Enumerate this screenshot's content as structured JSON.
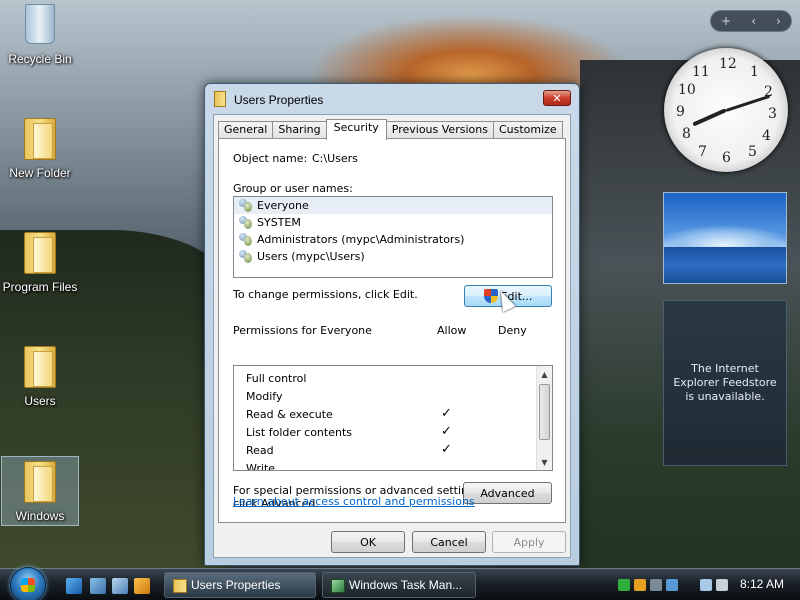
{
  "desktop": {
    "icons": [
      {
        "label": "Recycle Bin"
      },
      {
        "label": "New Folder"
      },
      {
        "label": "Program Files"
      },
      {
        "label": "Users"
      },
      {
        "label": "Windows"
      }
    ]
  },
  "gadgets": {
    "toolbar": {
      "add": "+",
      "prev": "‹",
      "next": "›"
    },
    "clock": {
      "time": "8:12"
    },
    "feed_message": "The Internet Explorer Feedstore is unavailable."
  },
  "window": {
    "title": "Users Properties",
    "close_glyph": "✕",
    "tabs": [
      {
        "label": "General"
      },
      {
        "label": "Sharing"
      },
      {
        "label": "Security"
      },
      {
        "label": "Previous Versions"
      },
      {
        "label": "Customize"
      }
    ],
    "active_tab": "Security",
    "object_name_label": "Object name:",
    "object_name_value": "C:\\Users",
    "group_label": "Group or user names:",
    "groups": [
      {
        "name": "Everyone"
      },
      {
        "name": "SYSTEM"
      },
      {
        "name": "Administrators (mypc\\Administrators)"
      },
      {
        "name": "Users (mypc\\Users)"
      }
    ],
    "change_text": "To change permissions, click Edit.",
    "edit_label": "Edit...",
    "permissions_label": "Permissions for Everyone",
    "allow_label": "Allow",
    "deny_label": "Deny",
    "permissions": [
      {
        "name": "Full control",
        "allow": "",
        "deny": ""
      },
      {
        "name": "Modify",
        "allow": "",
        "deny": ""
      },
      {
        "name": "Read & execute",
        "allow": "✓",
        "deny": ""
      },
      {
        "name": "List folder contents",
        "allow": "✓",
        "deny": ""
      },
      {
        "name": "Read",
        "allow": "✓",
        "deny": ""
      },
      {
        "name": "Write",
        "allow": "",
        "deny": ""
      }
    ],
    "special_text_1": "For special permissions or advanced settings,",
    "special_text_2": "click Advanced.",
    "advanced_label": "Advanced",
    "learn_link": "Learn about access control and permissions",
    "ok_label": "OK",
    "cancel_label": "Cancel",
    "apply_label": "Apply"
  },
  "taskbar": {
    "tasks": [
      {
        "label": "Users Properties"
      },
      {
        "label": "Windows Task Man..."
      }
    ],
    "clock": "8:12 AM"
  },
  "colors": {
    "accent": "#3c7fb1",
    "link": "#0066cc",
    "close": "#c9402a"
  }
}
